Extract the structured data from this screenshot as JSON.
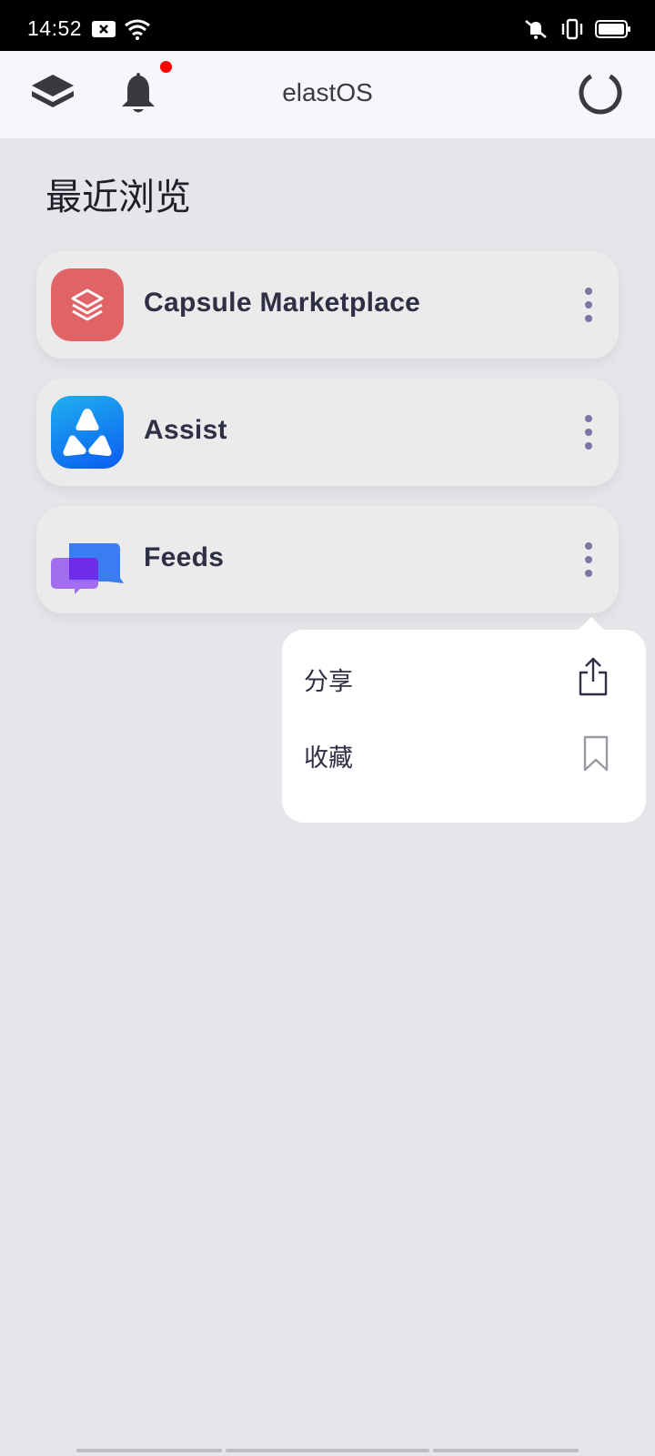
{
  "status_bar": {
    "time": "14:52"
  },
  "header": {
    "title": "elastOS"
  },
  "recent": {
    "title": "最近浏览",
    "items": [
      {
        "label": "Capsule Marketplace",
        "icon": "capsule-marketplace-icon"
      },
      {
        "label": "Assist",
        "icon": "assist-icon"
      },
      {
        "label": "Feeds",
        "icon": "feeds-icon"
      }
    ]
  },
  "popover": {
    "items": [
      {
        "label": "分享",
        "icon": "share-icon"
      },
      {
        "label": "收藏",
        "icon": "bookmark-icon"
      }
    ]
  },
  "colors": {
    "capsule_red": "#e06466",
    "assist_blue": "#0a6cf0",
    "feeds_purple": "#8f5cf0",
    "feeds_blue": "#3a7df0",
    "notification_dot": "#ff0000"
  }
}
